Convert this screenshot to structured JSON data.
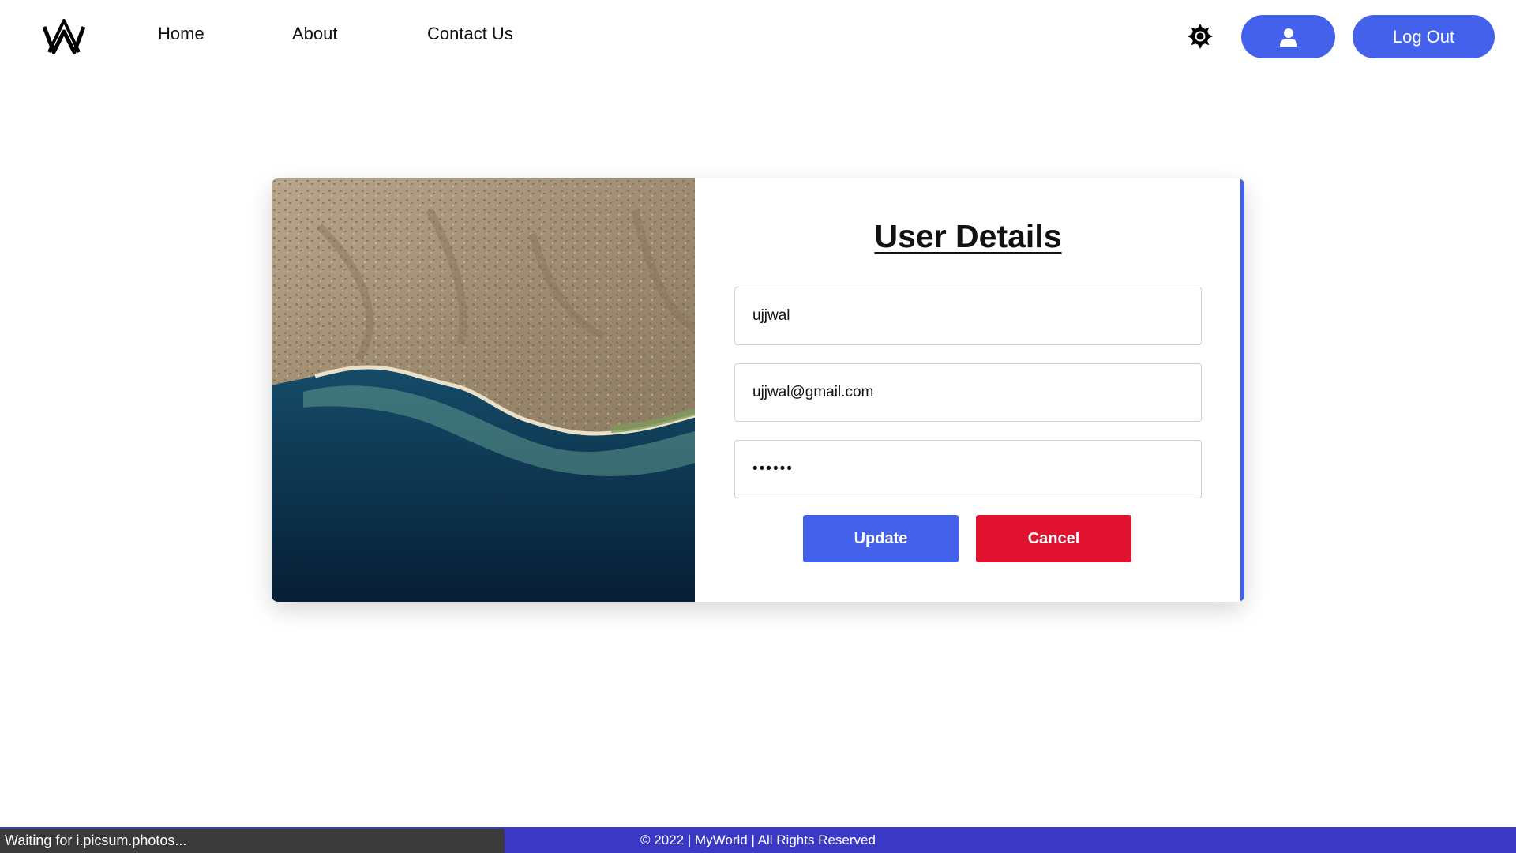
{
  "nav": {
    "logo_icon": "myworld-logo-icon",
    "links": [
      "Home",
      "About",
      "Contact Us"
    ],
    "theme_icon": "sun-icon",
    "profile_icon": "user-icon",
    "logout_label": "Log Out"
  },
  "form": {
    "title": "User Details",
    "name_value": "ujjwal",
    "email_value": "ujjwal@gmail.com",
    "password_value": "••••••",
    "update_label": "Update",
    "cancel_label": "Cancel"
  },
  "footer": {
    "text": "© 2022 | MyWorld | All Rights Reserved"
  },
  "status_bar": {
    "text": "Waiting for i.picsum.photos..."
  },
  "colors": {
    "accent": "#4461eb",
    "danger": "#e0122f",
    "footer_bg": "#3a38c4"
  }
}
